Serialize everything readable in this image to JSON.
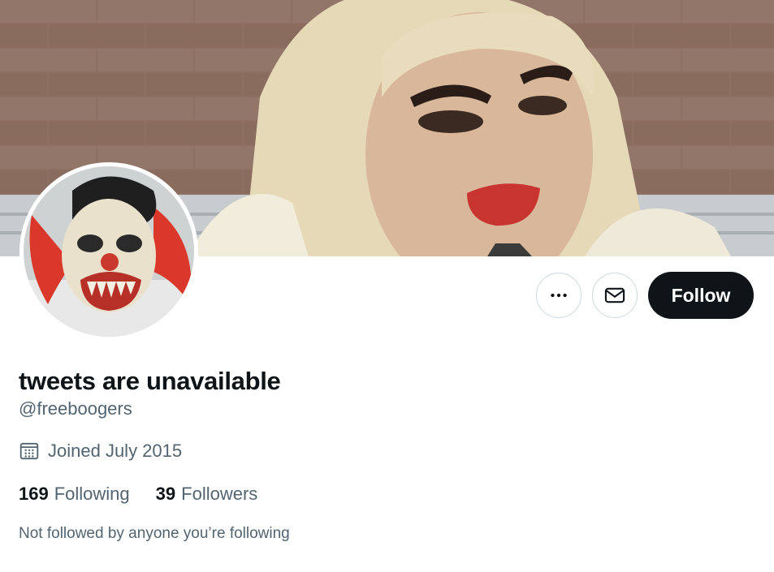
{
  "profile": {
    "display_name": "tweets are unavailable",
    "handle": "@freeboogers",
    "joined": "Joined July 2015",
    "following_count": "169",
    "following_label": "Following",
    "followers_count": "39",
    "followers_label": "Followers",
    "followed_by_note": "Not followed by anyone you’re following"
  },
  "actions": {
    "more_icon": "more-horizontal-icon",
    "message_icon": "envelope-icon",
    "follow_label": "Follow"
  },
  "icons": {
    "joined": "calendar-icon"
  }
}
